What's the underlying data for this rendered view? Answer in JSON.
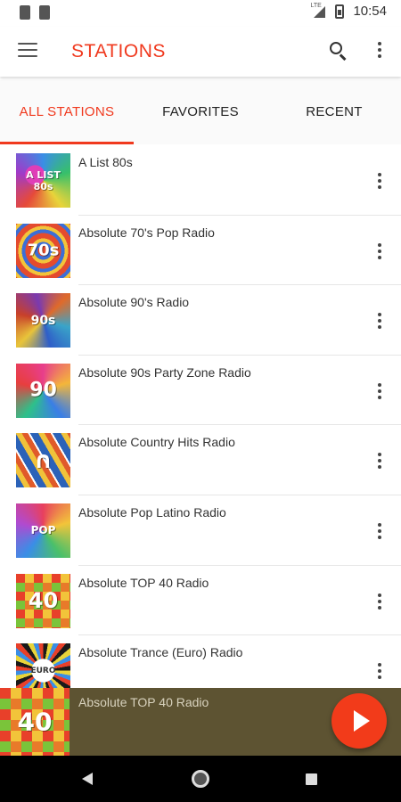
{
  "status_bar": {
    "time": "10:54",
    "network": "LTE"
  },
  "app_bar": {
    "title": "STATIONS"
  },
  "tabs": [
    {
      "label": "ALL STATIONS",
      "active": true
    },
    {
      "label": "FAVORITES",
      "active": false
    },
    {
      "label": "RECENT",
      "active": false
    }
  ],
  "stations": [
    {
      "name": "A List 80s",
      "art_text": "A LIST 80s"
    },
    {
      "name": "Absolute 70's Pop Radio",
      "art_text": "70s"
    },
    {
      "name": "Absolute 90's Radio",
      "art_text": "90s"
    },
    {
      "name": "Absolute 90s Party Zone Radio",
      "art_text": "90"
    },
    {
      "name": "Absolute Country Hits Radio",
      "art_text": "∩"
    },
    {
      "name": "Absolute Pop Latino Radio",
      "art_text": "POP"
    },
    {
      "name": "Absolute TOP 40 Radio",
      "art_text": "40"
    },
    {
      "name": "Absolute Trance (Euro) Radio",
      "art_text": "EURO"
    }
  ],
  "player": {
    "now_playing": "Absolute TOP 40 Radio",
    "art_text": "40",
    "state": "paused"
  },
  "colors": {
    "accent": "#f0391e",
    "player_bg": "#5d5332",
    "play_button": "#f23b1a"
  }
}
